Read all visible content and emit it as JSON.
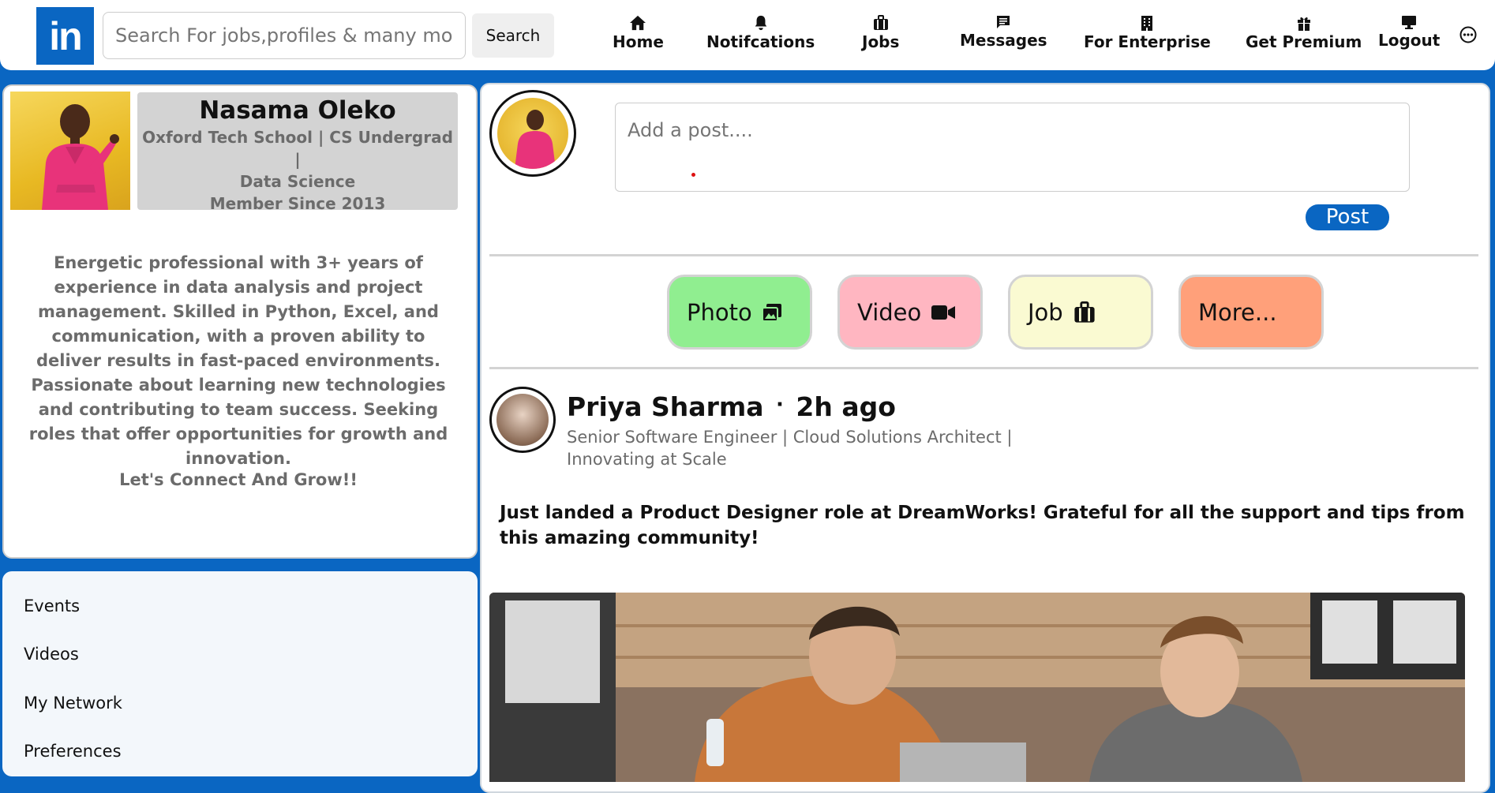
{
  "header": {
    "logo_text": "in",
    "search_placeholder": "Search For jobs,profiles & many more....",
    "search_button": "Search",
    "nav": [
      {
        "label": "Home",
        "icon": "home-icon"
      },
      {
        "label": "Notifcations",
        "icon": "bell-icon"
      },
      {
        "label": "Jobs",
        "icon": "briefcase-icon"
      },
      {
        "label": "Messages",
        "icon": "message-icon"
      },
      {
        "label": "For Enterprise",
        "icon": "building-icon"
      },
      {
        "label": "Get Premium",
        "icon": "gift-icon"
      },
      {
        "label": "Logout",
        "icon": "monitor-icon"
      }
    ],
    "more_icon": "ellipsis-circle-icon"
  },
  "profile": {
    "name": "Nasama Oleko",
    "headline_1": "Oxford Tech School | CS Undergrad |",
    "headline_2": "Data Science",
    "member_since": "Member Since 2013",
    "bio": "Energetic professional with 3+ years of experience in data analysis and project management. Skilled in Python, Excel, and communication, with a proven ability to deliver results in fast-paced environments. Passionate about learning new technologies and contributing to team success. Seeking roles that offer opportunities for growth and innovation.",
    "bio_cta": "Let's Connect And Grow!!"
  },
  "menu": {
    "items": [
      "Events",
      "Videos",
      "My Network",
      "Preferences"
    ]
  },
  "composer": {
    "placeholder": "Add a post....",
    "post_button": "Post",
    "media_buttons": [
      {
        "label": "Photo",
        "icon": "image-icon",
        "color": "#90ee90"
      },
      {
        "label": "Video",
        "icon": "video-camera-icon",
        "color": "#ffb6c1"
      },
      {
        "label": "Job",
        "icon": "briefcase-icon",
        "color": "#fafad2"
      },
      {
        "label": "More...",
        "icon": "",
        "color": "#ffa07a"
      }
    ]
  },
  "feed": {
    "author": "Priya Sharma",
    "separator": "·",
    "time": "2h ago",
    "role": "Senior Software Engineer | Cloud Solutions Architect | Innovating at Scale",
    "text": "Just landed a Product Designer role at DreamWorks! Grateful for all the support and tips from this amazing community!"
  },
  "colors": {
    "brand": "#0a66c2",
    "muted_text": "#6b6b6b",
    "name_box": "#d3d3d3"
  }
}
